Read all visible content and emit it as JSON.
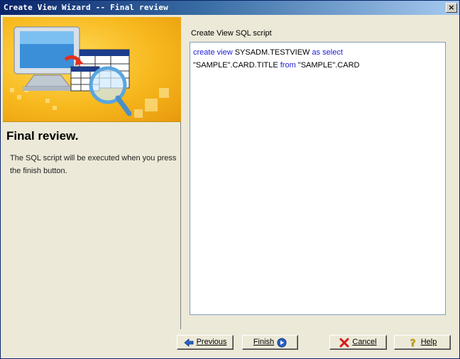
{
  "window": {
    "title": "Create View Wizard -- Final review",
    "close_glyph": "×"
  },
  "left": {
    "heading": "Final review.",
    "description": "The SQL script will be executed when you press the finish button."
  },
  "right": {
    "label": "Create View SQL script",
    "sql": {
      "line1_kw1": "create view",
      "line1_name": " SYSADM.TESTVIEW ",
      "line1_kw2": "as select",
      "line2_part1": "\"SAMPLE\".CARD.TITLE ",
      "line2_kw": "from",
      "line2_part2": " \"SAMPLE\".CARD"
    }
  },
  "buttons": {
    "previous": "Previous",
    "finish": "Finish",
    "cancel": "Cancel",
    "help": "Help"
  },
  "icons": {
    "previous": "arrow-left-icon",
    "finish": "arrow-right-circle-icon",
    "cancel": "red-x-icon",
    "help": "question-mark-icon"
  },
  "colors": {
    "keyword": "#1c1cd8",
    "title_bar": "#0a246a"
  }
}
